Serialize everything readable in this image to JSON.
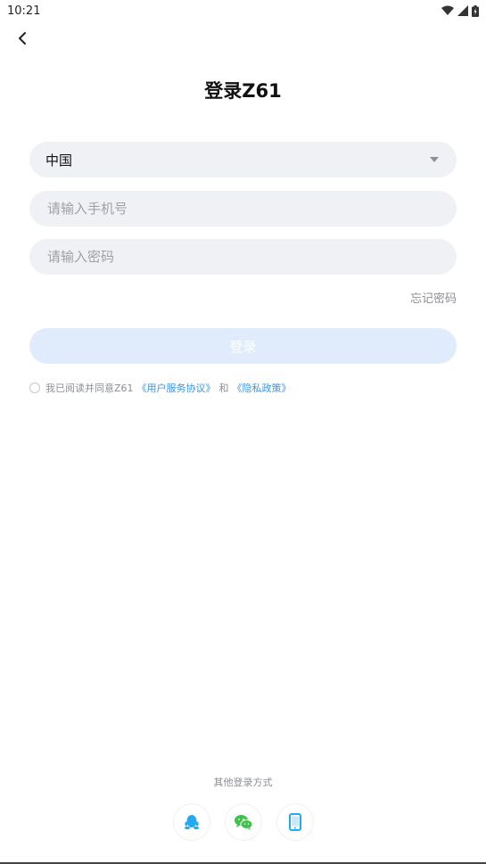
{
  "status_bar": {
    "time": "10:21"
  },
  "title": "登录Z61",
  "country": {
    "value": "中国"
  },
  "phone": {
    "placeholder": "请输入手机号"
  },
  "password": {
    "placeholder": "请输入密码"
  },
  "forgot_password": "忘记密码",
  "login_button": "登录",
  "agreement": {
    "prefix": "我已阅读并同意Z61",
    "terms_link": "《用户服务协议》",
    "and": "和",
    "privacy_link": "《隐私政策》"
  },
  "other_login": {
    "label": "其他登录方式",
    "methods": [
      "qq-icon",
      "wechat-icon",
      "phone-icon"
    ]
  },
  "colors": {
    "accent": "#3b93e6",
    "login_button_bg": "#e0ecfc",
    "field_bg": "#f0f1f5",
    "wechat": "#3dc24a",
    "qq": "#22a9f0"
  }
}
